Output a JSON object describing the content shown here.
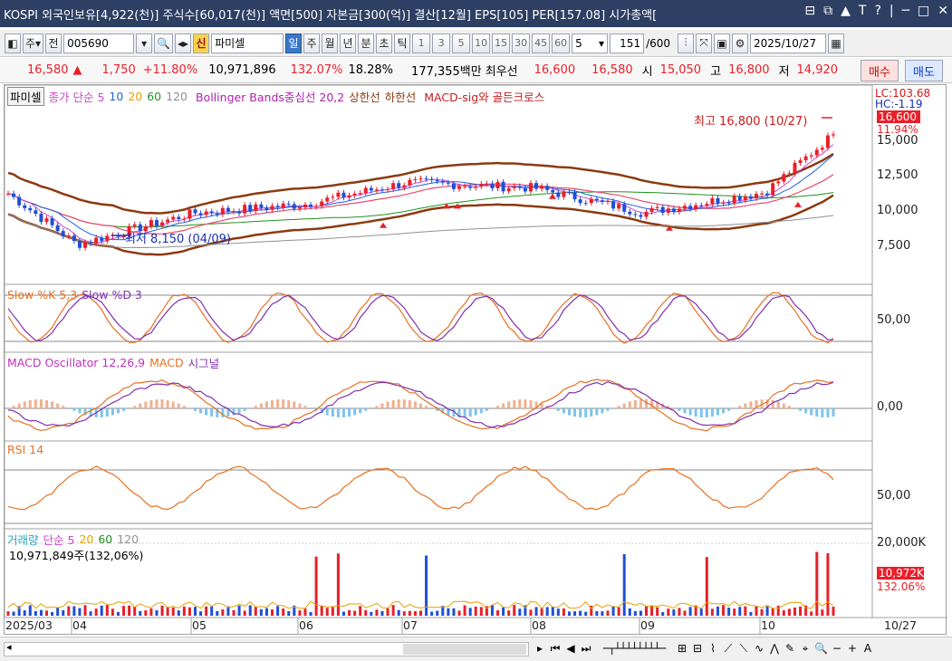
{
  "window": {
    "title": "KOSPI 외국인보유[4,922(천)] 주식수[60,017(천)] 액면[500] 자본금[300(억)] 결산[12월] EPS[105] PER[157.08] 시가총액[",
    "controls": [
      "⊟",
      "⧉",
      "▲",
      "T",
      "?",
      "|",
      "─",
      "□",
      "✕"
    ]
  },
  "toolbar": {
    "period_label": "주",
    "prev_label": "전",
    "code": "005690",
    "new_badge": "신",
    "name": "파미셀",
    "periods": [
      "일",
      "주",
      "월",
      "년",
      "분",
      "초",
      "틱"
    ],
    "selected_period": "일",
    "intervals": [
      "1",
      "3",
      "5",
      "10",
      "15",
      "30",
      "45",
      "60"
    ],
    "count_select": "5",
    "range_display": "151",
    "range_total": "/600",
    "date": "2025/10/27"
  },
  "quote": {
    "price": "16,580",
    "arrow": "▲",
    "change": "1,750",
    "change_pct": "+11.80%",
    "volume": "10,971,896",
    "vol_ratio": "132.07%",
    "turnover": "18.28%",
    "amount": "177,355백만",
    "best_label": "최우선",
    "ask": "16,600",
    "bid": "16,580",
    "open_label": "시",
    "open": "15,050",
    "high_label": "고",
    "high": "16,800",
    "low_label": "저",
    "low": "14,920",
    "buy_label": "매수",
    "sell_label": "매도"
  },
  "legend": {
    "price": {
      "name": "파미셀",
      "ma_label": "종가 단순 5",
      "ma10": "10",
      "ma20": "20",
      "ma60": "60",
      "ma120": "120",
      "bb": "Bollinger Bands중심선 20,2",
      "bb_upper": "상한선",
      "bb_lower": "하한선",
      "macd_sig": "MACD-sig와 골든크로스"
    },
    "stoch": {
      "k": "Slow %K 5,3",
      "d": "Slow %D 3"
    },
    "macd": {
      "osc": "MACD Oscillator 12,26,9",
      "macd": "MACD",
      "signal": "시그널"
    },
    "rsi": {
      "name": "RSI 14"
    },
    "volume": {
      "name": "거래량",
      "ma": "단순 5",
      "ma20": "20",
      "ma60": "60",
      "ma120": "120",
      "current": "10,971,849주(132,06%)"
    }
  },
  "annotations": {
    "high": "최고 16,800 (10/27)",
    "low": "최저 8,150 (04/09)",
    "lc": "LC:103.68",
    "hc": "HC:-1.19",
    "price_tag": "16,600",
    "pct_tag": "11.94%",
    "vol_tag": "10,972K",
    "vol_pct_tag": "132.06%"
  },
  "axis": {
    "price_ticks": [
      "15,000",
      "12,500",
      "10,000",
      "7,500"
    ],
    "stoch_tick": "50,00",
    "macd_tick": "0,00",
    "rsi_tick": "50,00",
    "vol_tick": "20,000K",
    "x_labels": [
      "2025/03",
      "04",
      "05",
      "06",
      "07",
      "08",
      "09",
      "10"
    ],
    "x_last": "10/27"
  },
  "colors": {
    "up": "#e8202a",
    "down": "#1f4fd6",
    "bb": "#8b3a10",
    "ma5": "#cc44cc",
    "ma10": "#2060e0",
    "ma20": "#e8a000",
    "ma60": "#209020",
    "ma120": "#909090"
  },
  "chart_data": {
    "type": "line",
    "title": "",
    "x": [
      "2025/03",
      "04",
      "05",
      "06",
      "07",
      "08",
      "09",
      "10",
      "10/27"
    ],
    "series": [
      {
        "name": "종가",
        "values": [
          12300,
          8600,
          10900,
          11500,
          13100,
          12700,
          10900,
          12400,
          16580
        ]
      }
    ],
    "ylim": [
      6500,
      17000
    ],
    "high": {
      "value": 16800,
      "date": "10/27"
    },
    "low": {
      "value": 8150,
      "date": "04/09"
    }
  }
}
